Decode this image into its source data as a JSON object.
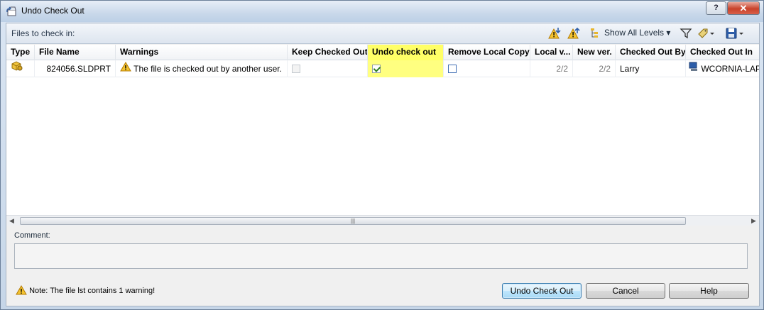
{
  "window": {
    "title": "Undo Check Out",
    "help_label": "?",
    "close_label": "✕"
  },
  "toolbar": {
    "files_label": "Files to check in:",
    "show_levels_label": "Show All Levels ▾"
  },
  "grid": {
    "columns": [
      "Type",
      "File Name",
      "Warnings",
      "Keep Checked Out",
      "Undo check out",
      "Remove Local Copy",
      "Local v...",
      "New ver.",
      "Checked Out By",
      "Checked Out In"
    ],
    "rows": [
      {
        "type_icon": "part-icon",
        "file_name": "824056.SLDPRT",
        "warning": "The file is checked out by another user.",
        "keep_checked_out": false,
        "undo_check_out": true,
        "remove_local_copy": false,
        "local_version": "2/2",
        "new_version": "2/2",
        "checked_out_by": "Larry",
        "checked_out_in": "WCORNIA-LAP"
      }
    ]
  },
  "comment": {
    "label": "Comment:",
    "value": ""
  },
  "footer": {
    "note": "Note: The file lst contains 1 warning!",
    "undo_button": "Undo Check Out",
    "cancel_button": "Cancel",
    "help_button": "Help"
  },
  "colors": {
    "highlight": "#ffff66",
    "accent": "#3c7fb1"
  }
}
